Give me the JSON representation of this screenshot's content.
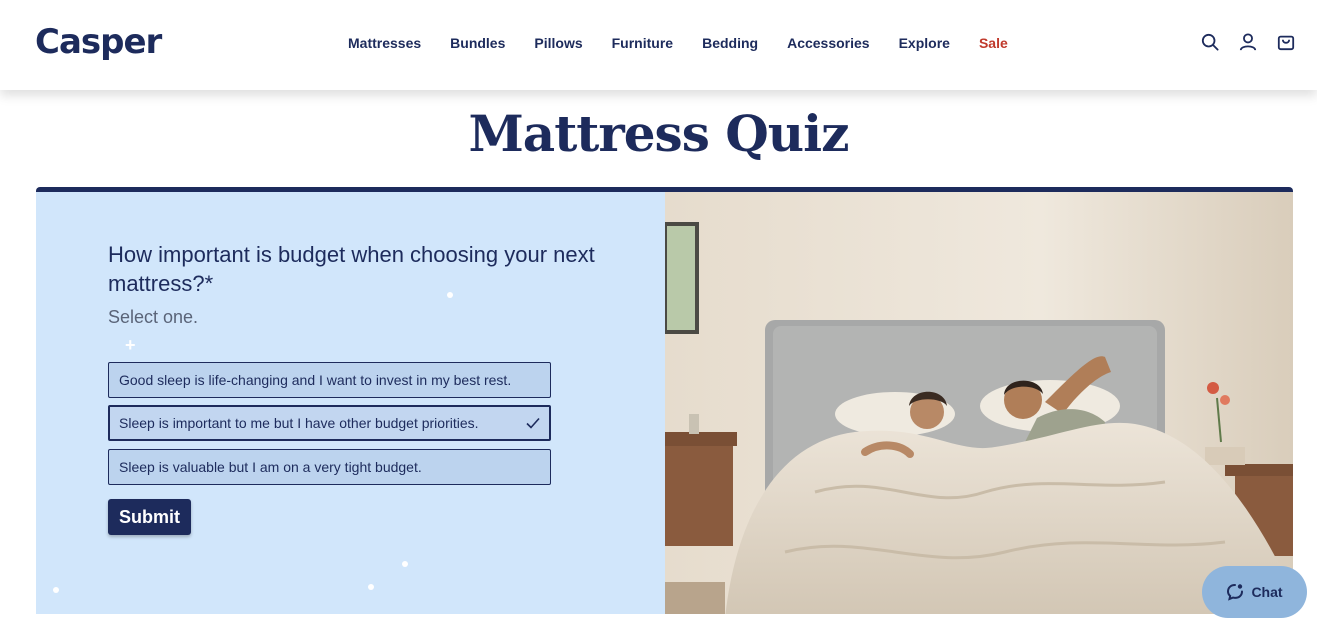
{
  "brand": {
    "logo": "Casper"
  },
  "nav": {
    "items": [
      {
        "label": "Mattresses"
      },
      {
        "label": "Bundles"
      },
      {
        "label": "Pillows"
      },
      {
        "label": "Furniture"
      },
      {
        "label": "Bedding"
      },
      {
        "label": "Accessories"
      },
      {
        "label": "Explore"
      },
      {
        "label": "Sale"
      }
    ],
    "icons": [
      "search-icon",
      "account-icon",
      "cart-icon"
    ]
  },
  "page": {
    "title": "Mattress Quiz"
  },
  "quiz": {
    "question": "How important is budget when choosing your next mattress?*",
    "instruction": "Select one.",
    "options": [
      {
        "label": "Good sleep is life-changing and I want to invest in my best rest.",
        "selected": false
      },
      {
        "label": "Sleep is important to me but I have other budget priorities.",
        "selected": true
      },
      {
        "label": "Sleep is valuable but I am on a very tight budget.",
        "selected": false
      }
    ],
    "submit_label": "Submit"
  },
  "chat": {
    "label": "Chat"
  },
  "colors": {
    "navy": "#1d2b5c",
    "quiz_bg": "#d1e6fb",
    "sale": "#c0392b",
    "chat_bg": "#8fb5dc"
  }
}
